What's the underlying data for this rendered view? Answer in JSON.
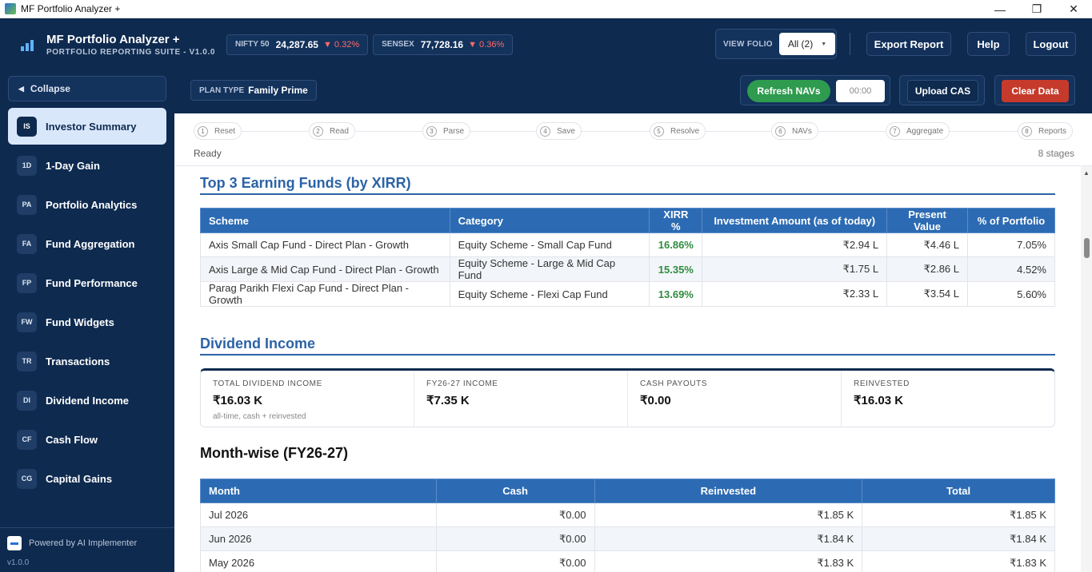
{
  "window": {
    "title": "MF Portfolio Analyzer +",
    "controls": [
      "—",
      "❐",
      "✕"
    ]
  },
  "header": {
    "app_title": "MF Portfolio Analyzer +",
    "app_subtitle": "PORTFOLIO REPORTING SUITE - V1.0.0",
    "tickers": [
      {
        "name": "NIFTY 50",
        "value": "24,287.65",
        "change": "▼ 0.32%"
      },
      {
        "name": "SENSEX",
        "value": "77,728.16",
        "change": "▼ 0.36%"
      }
    ],
    "view_folio_label": "VIEW FOLIO",
    "view_folio_value": "All (2)",
    "buttons": {
      "export": "Export Report",
      "help": "Help",
      "logout": "Logout"
    }
  },
  "sidebar": {
    "collapse_label": "Collapse",
    "items": [
      {
        "abbr": "IS",
        "label": "Investor Summary",
        "active": true
      },
      {
        "abbr": "1D",
        "label": "1-Day Gain"
      },
      {
        "abbr": "PA",
        "label": "Portfolio Analytics"
      },
      {
        "abbr": "FA",
        "label": "Fund Aggregation"
      },
      {
        "abbr": "FP",
        "label": "Fund Performance"
      },
      {
        "abbr": "FW",
        "label": "Fund Widgets"
      },
      {
        "abbr": "TR",
        "label": "Transactions"
      },
      {
        "abbr": "DI",
        "label": "Dividend Income"
      },
      {
        "abbr": "CF",
        "label": "Cash Flow"
      },
      {
        "abbr": "CG",
        "label": "Capital Gains"
      }
    ],
    "powered_by": "Powered by AI Implementer",
    "version": "v1.0.0"
  },
  "toolbar": {
    "plan_type_label": "PLAN TYPE",
    "plan_type_value": "Family Prime",
    "refresh_label": "Refresh NAVs",
    "timer": "00:00",
    "upload_label": "Upload CAS",
    "clear_label": "Clear Data"
  },
  "stages": {
    "items": [
      {
        "n": "1",
        "label": "Reset"
      },
      {
        "n": "2",
        "label": "Read"
      },
      {
        "n": "3",
        "label": "Parse"
      },
      {
        "n": "4",
        "label": "Save"
      },
      {
        "n": "5",
        "label": "Resolve"
      },
      {
        "n": "6",
        "label": "NAVs"
      },
      {
        "n": "7",
        "label": "Aggregate"
      },
      {
        "n": "8",
        "label": "Reports"
      }
    ],
    "status": "Ready",
    "count_label": "8 stages"
  },
  "top_funds": {
    "title": "Top 3 Earning Funds (by XIRR)",
    "columns": [
      "Scheme",
      "Category",
      "XIRR %",
      "Investment Amount (as of today)",
      "Present Value",
      "% of Portfolio"
    ],
    "rows": [
      [
        "Axis Small Cap Fund - Direct Plan - Growth",
        "Equity Scheme - Small Cap Fund",
        "16.86%",
        "₹2.94 L",
        "₹4.46 L",
        "7.05%"
      ],
      [
        "Axis Large & Mid Cap Fund - Direct Plan - Growth",
        "Equity Scheme - Large & Mid Cap Fund",
        "15.35%",
        "₹1.75 L",
        "₹2.86 L",
        "4.52%"
      ],
      [
        "Parag Parikh Flexi Cap Fund - Direct Plan - Growth",
        "Equity Scheme - Flexi Cap Fund",
        "13.69%",
        "₹2.33 L",
        "₹3.54 L",
        "5.60%"
      ]
    ]
  },
  "dividend": {
    "title": "Dividend Income",
    "cards": [
      {
        "label": "TOTAL DIVIDEND INCOME",
        "value": "₹16.03 K",
        "sub": "all-time, cash + reinvested"
      },
      {
        "label": "FY26-27 INCOME",
        "value": "₹7.35 K",
        "sub": ""
      },
      {
        "label": "CASH PAYOUTS",
        "value": "₹0.00",
        "sub": ""
      },
      {
        "label": "REINVESTED",
        "value": "₹16.03 K",
        "sub": ""
      }
    ]
  },
  "monthwise": {
    "title": "Month-wise (FY26-27)",
    "columns": [
      "Month",
      "Cash",
      "Reinvested",
      "Total"
    ],
    "rows": [
      [
        "Jul 2026",
        "₹0.00",
        "₹1.85 K",
        "₹1.85 K"
      ],
      [
        "Jun 2026",
        "₹0.00",
        "₹1.84 K",
        "₹1.84 K"
      ],
      [
        "May 2026",
        "₹0.00",
        "₹1.83 K",
        "₹1.83 K"
      ]
    ]
  }
}
